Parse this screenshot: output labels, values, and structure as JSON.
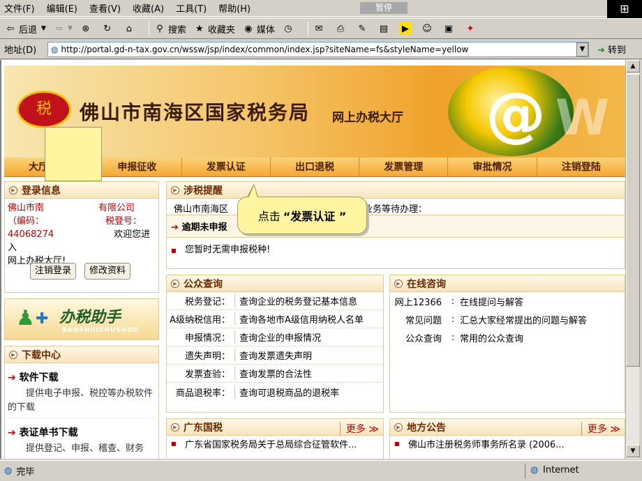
{
  "menu": [
    "文件(F)",
    "编辑(E)",
    "查看(V)",
    "收藏(A)",
    "工具(T)",
    "帮助(H)"
  ],
  "pause_label": "暂停",
  "toolbar": {
    "back": "后退",
    "search": "搜索",
    "favorites": "收藏夹",
    "media": "媒体"
  },
  "address": {
    "label": "地址(D)",
    "url": "http://portal.gd-n-tax.gov.cn/wssw/jsp/index/common/index.jsp?siteName=fs&styleName=yellow",
    "go": "转到"
  },
  "banner": {
    "title": "佛山市南海区国家税务局",
    "subtitle": "网上办税大厅"
  },
  "nav": [
    "大厅首页",
    "申报征收",
    "发票认证",
    "出口退税",
    "发票管理",
    "审批情况",
    "注销登陆"
  ],
  "login": {
    "header": "登录信息",
    "line1": "佛山市南",
    "line1b": "有限公司",
    "line2": "（编码：",
    "line2b": "税登号：",
    "line3": "44068274",
    "line3b": "欢迎您进入",
    "line4": "网上办税大厅!",
    "logout": "注销登录",
    "edit": "修改资料"
  },
  "assistant": {
    "title": "办税助手",
    "sub": "BANSHUIZHUSHOU"
  },
  "download": {
    "header": "下载中心",
    "items": [
      {
        "title": "软件下载",
        "desc": "提供电子申报、税控等办税软件的下载"
      },
      {
        "title": "表证单书下载",
        "desc": "提供登记、申报、稽查、财务"
      }
    ]
  },
  "reminder": {
    "header": "涉税提醒",
    "line1a": "佛山市南海区",
    "line1b": "业务等待办理：",
    "overdue_header": "逾期未申报",
    "item": "您暂时无需申报税种!"
  },
  "callout": {
    "prefix": "点击",
    "target": "“发票认证 ”"
  },
  "public_query": {
    "header": "公众查询",
    "rows": [
      {
        "k": "税务登记：",
        "v": "查询企业的税务登记基本信息"
      },
      {
        "k": "A级纳税信用：",
        "v": "查询各地市A级信用纳税人名单"
      },
      {
        "k": "申报情况：",
        "v": "查询企业的申报情况"
      },
      {
        "k": "遗失声明：",
        "v": "查询发票遗失声明"
      },
      {
        "k": "发票查验：",
        "v": "查询发票的合法性"
      },
      {
        "k": "商品退税率：",
        "v": "查询可退税商品的退税率"
      }
    ]
  },
  "consult": {
    "header": "在线咨询",
    "rows": [
      {
        "k": "网上12366",
        "v": "在线提问与解答"
      },
      {
        "k": "常见问题",
        "v": "汇总大家经常提出的问题与解答"
      },
      {
        "k": "公众查询",
        "v": "常用的公众查询"
      }
    ]
  },
  "gd_tax": {
    "header": "广东国税",
    "more": "更多 ≫",
    "items": [
      "广东省国家税务局关于总局综合征管软件..."
    ]
  },
  "notice": {
    "header": "地方公告",
    "more": "更多 ≫",
    "items": [
      "佛山市注册税务师事务所名录 (2006..."
    ]
  },
  "status": {
    "text": "完毕",
    "zone": "Internet"
  }
}
